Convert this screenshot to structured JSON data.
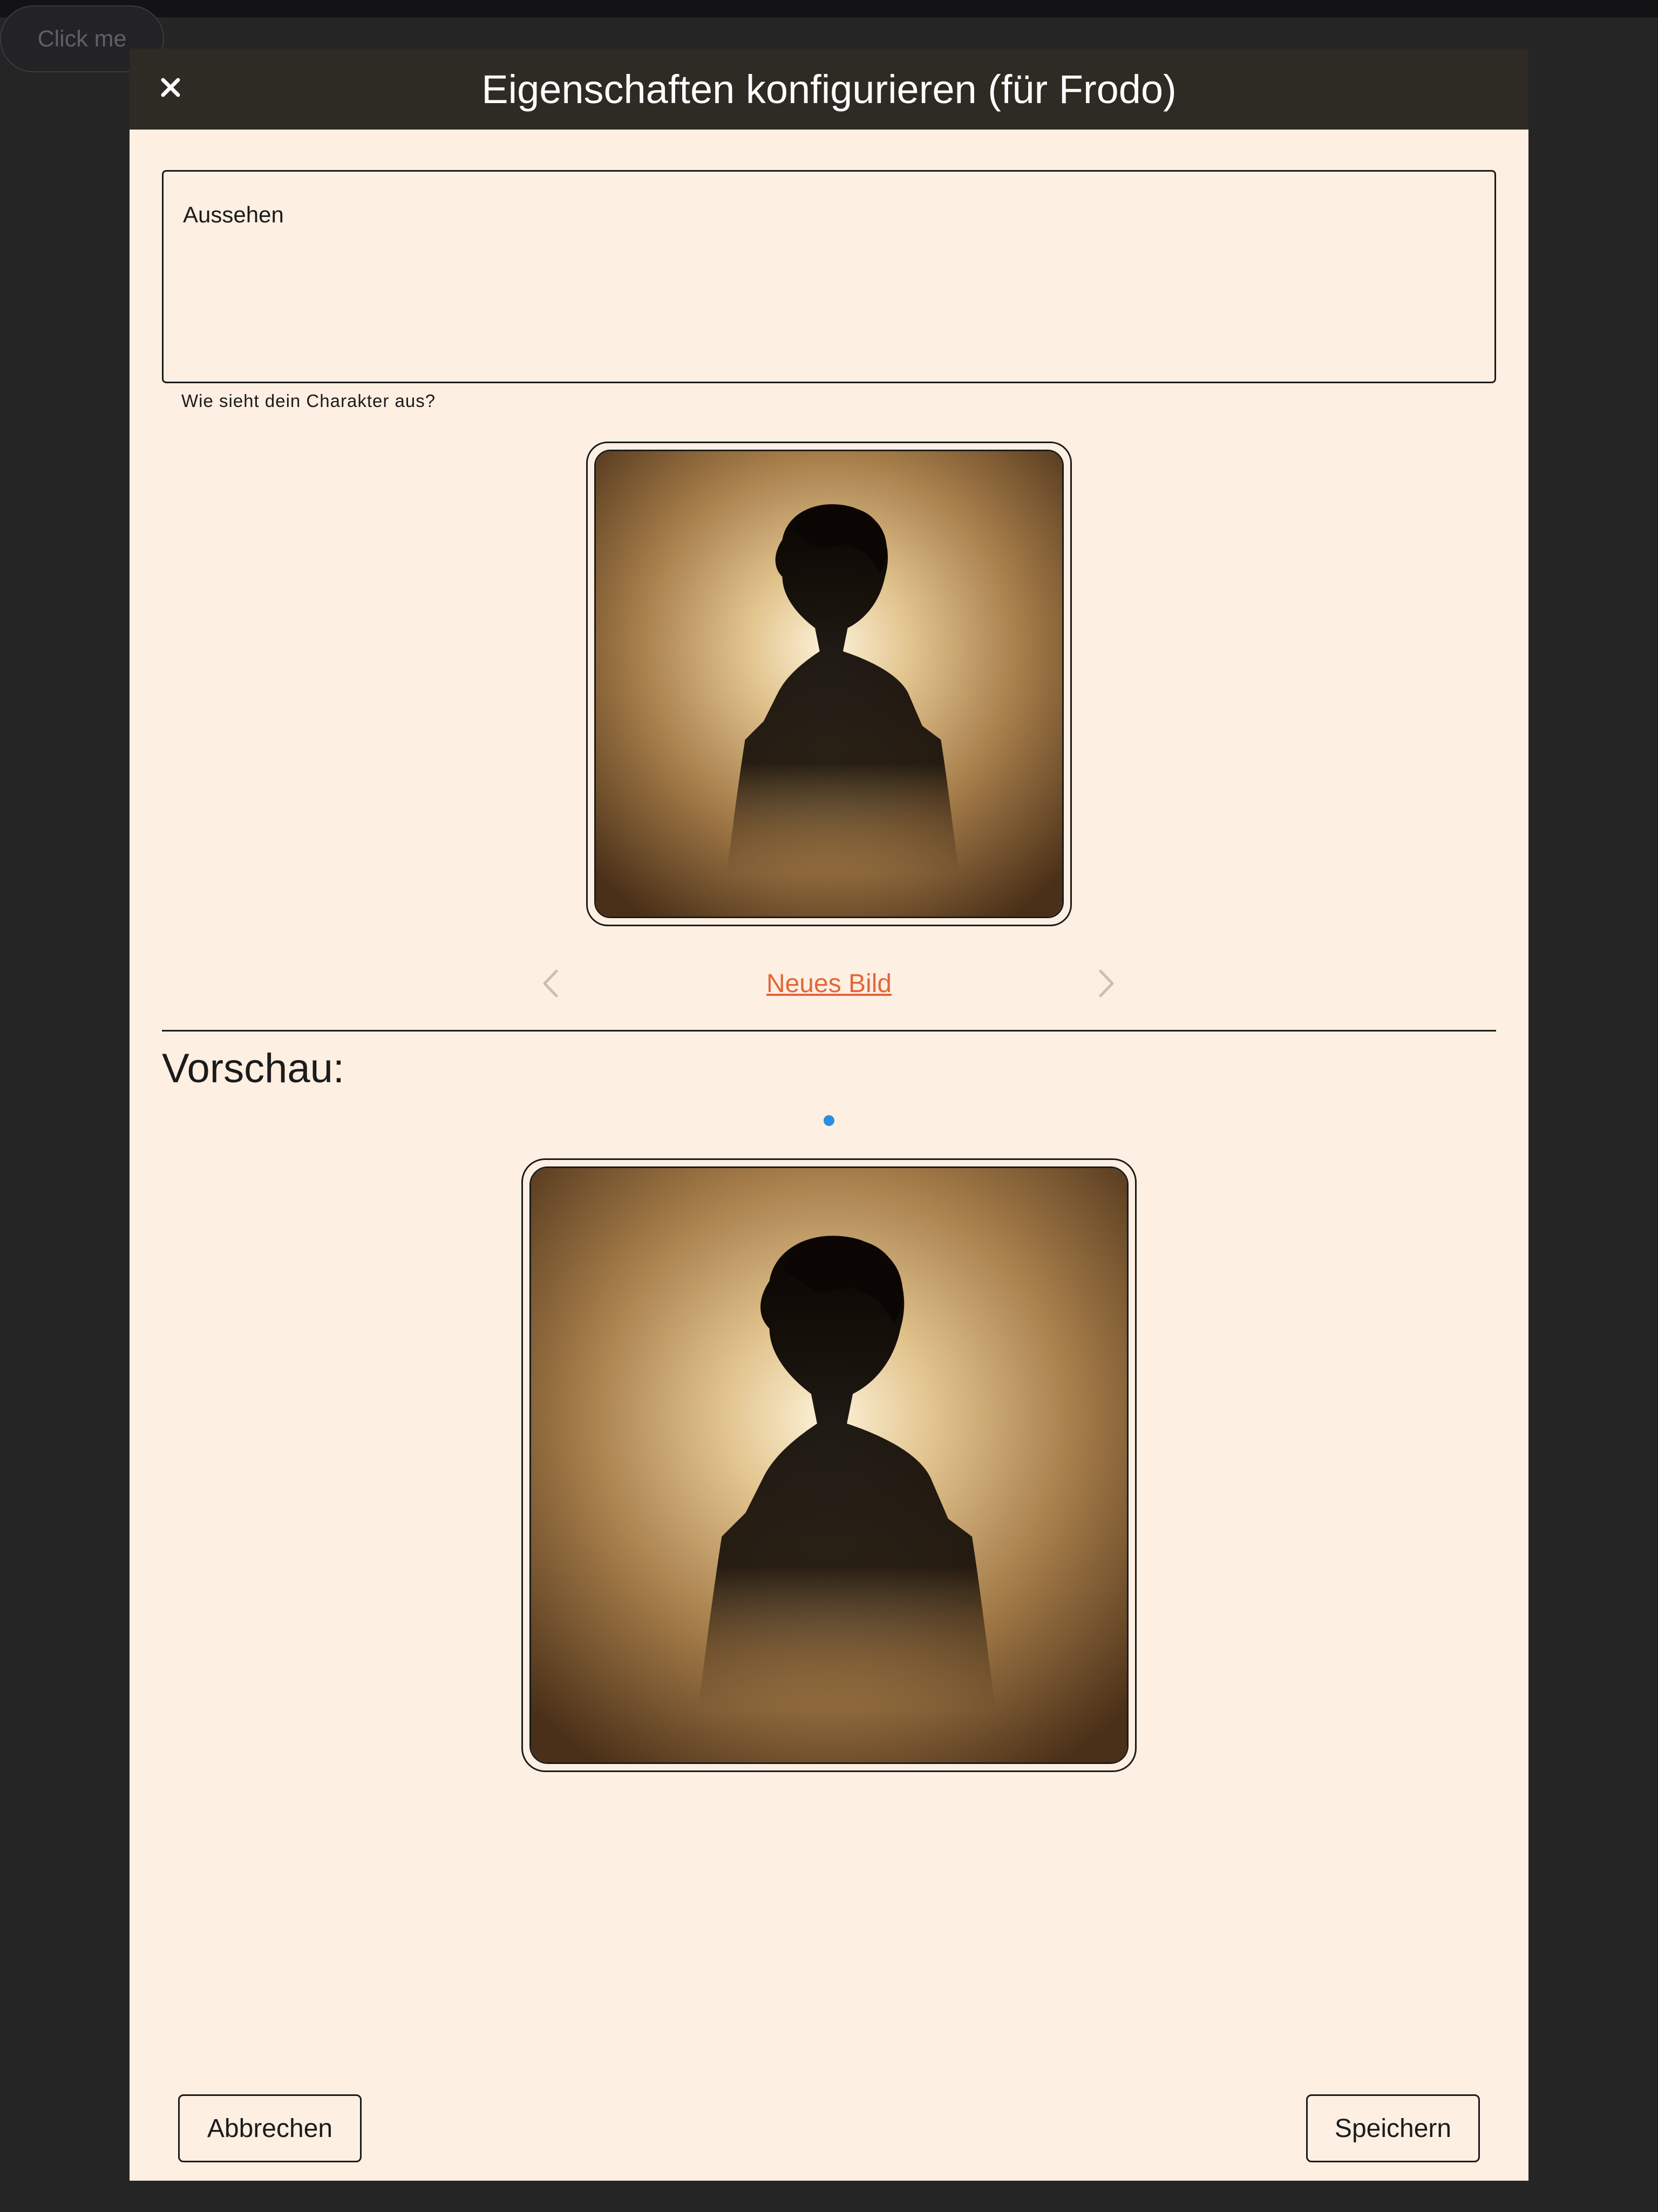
{
  "background_button": {
    "label": "Click me"
  },
  "dialog": {
    "title": "Eigenschaften konfigurieren (für Frodo)",
    "close_icon": "close-icon"
  },
  "appearance": {
    "label": "Aussehen",
    "value": "",
    "helper": "Wie sieht dein Charakter aus?"
  },
  "image_selector": {
    "prev_icon": "chevron-left-icon",
    "next_icon": "chevron-right-icon",
    "new_image_label": "Neues Bild"
  },
  "preview": {
    "heading": "Vorschau:"
  },
  "footer": {
    "cancel_label": "Abbrechen",
    "save_label": "Speichern"
  },
  "colors": {
    "dialog_background": "#fdefe2",
    "header_background": "#2e2a24",
    "link": "#e2673a",
    "page_indicator": "#2b8ee0"
  }
}
